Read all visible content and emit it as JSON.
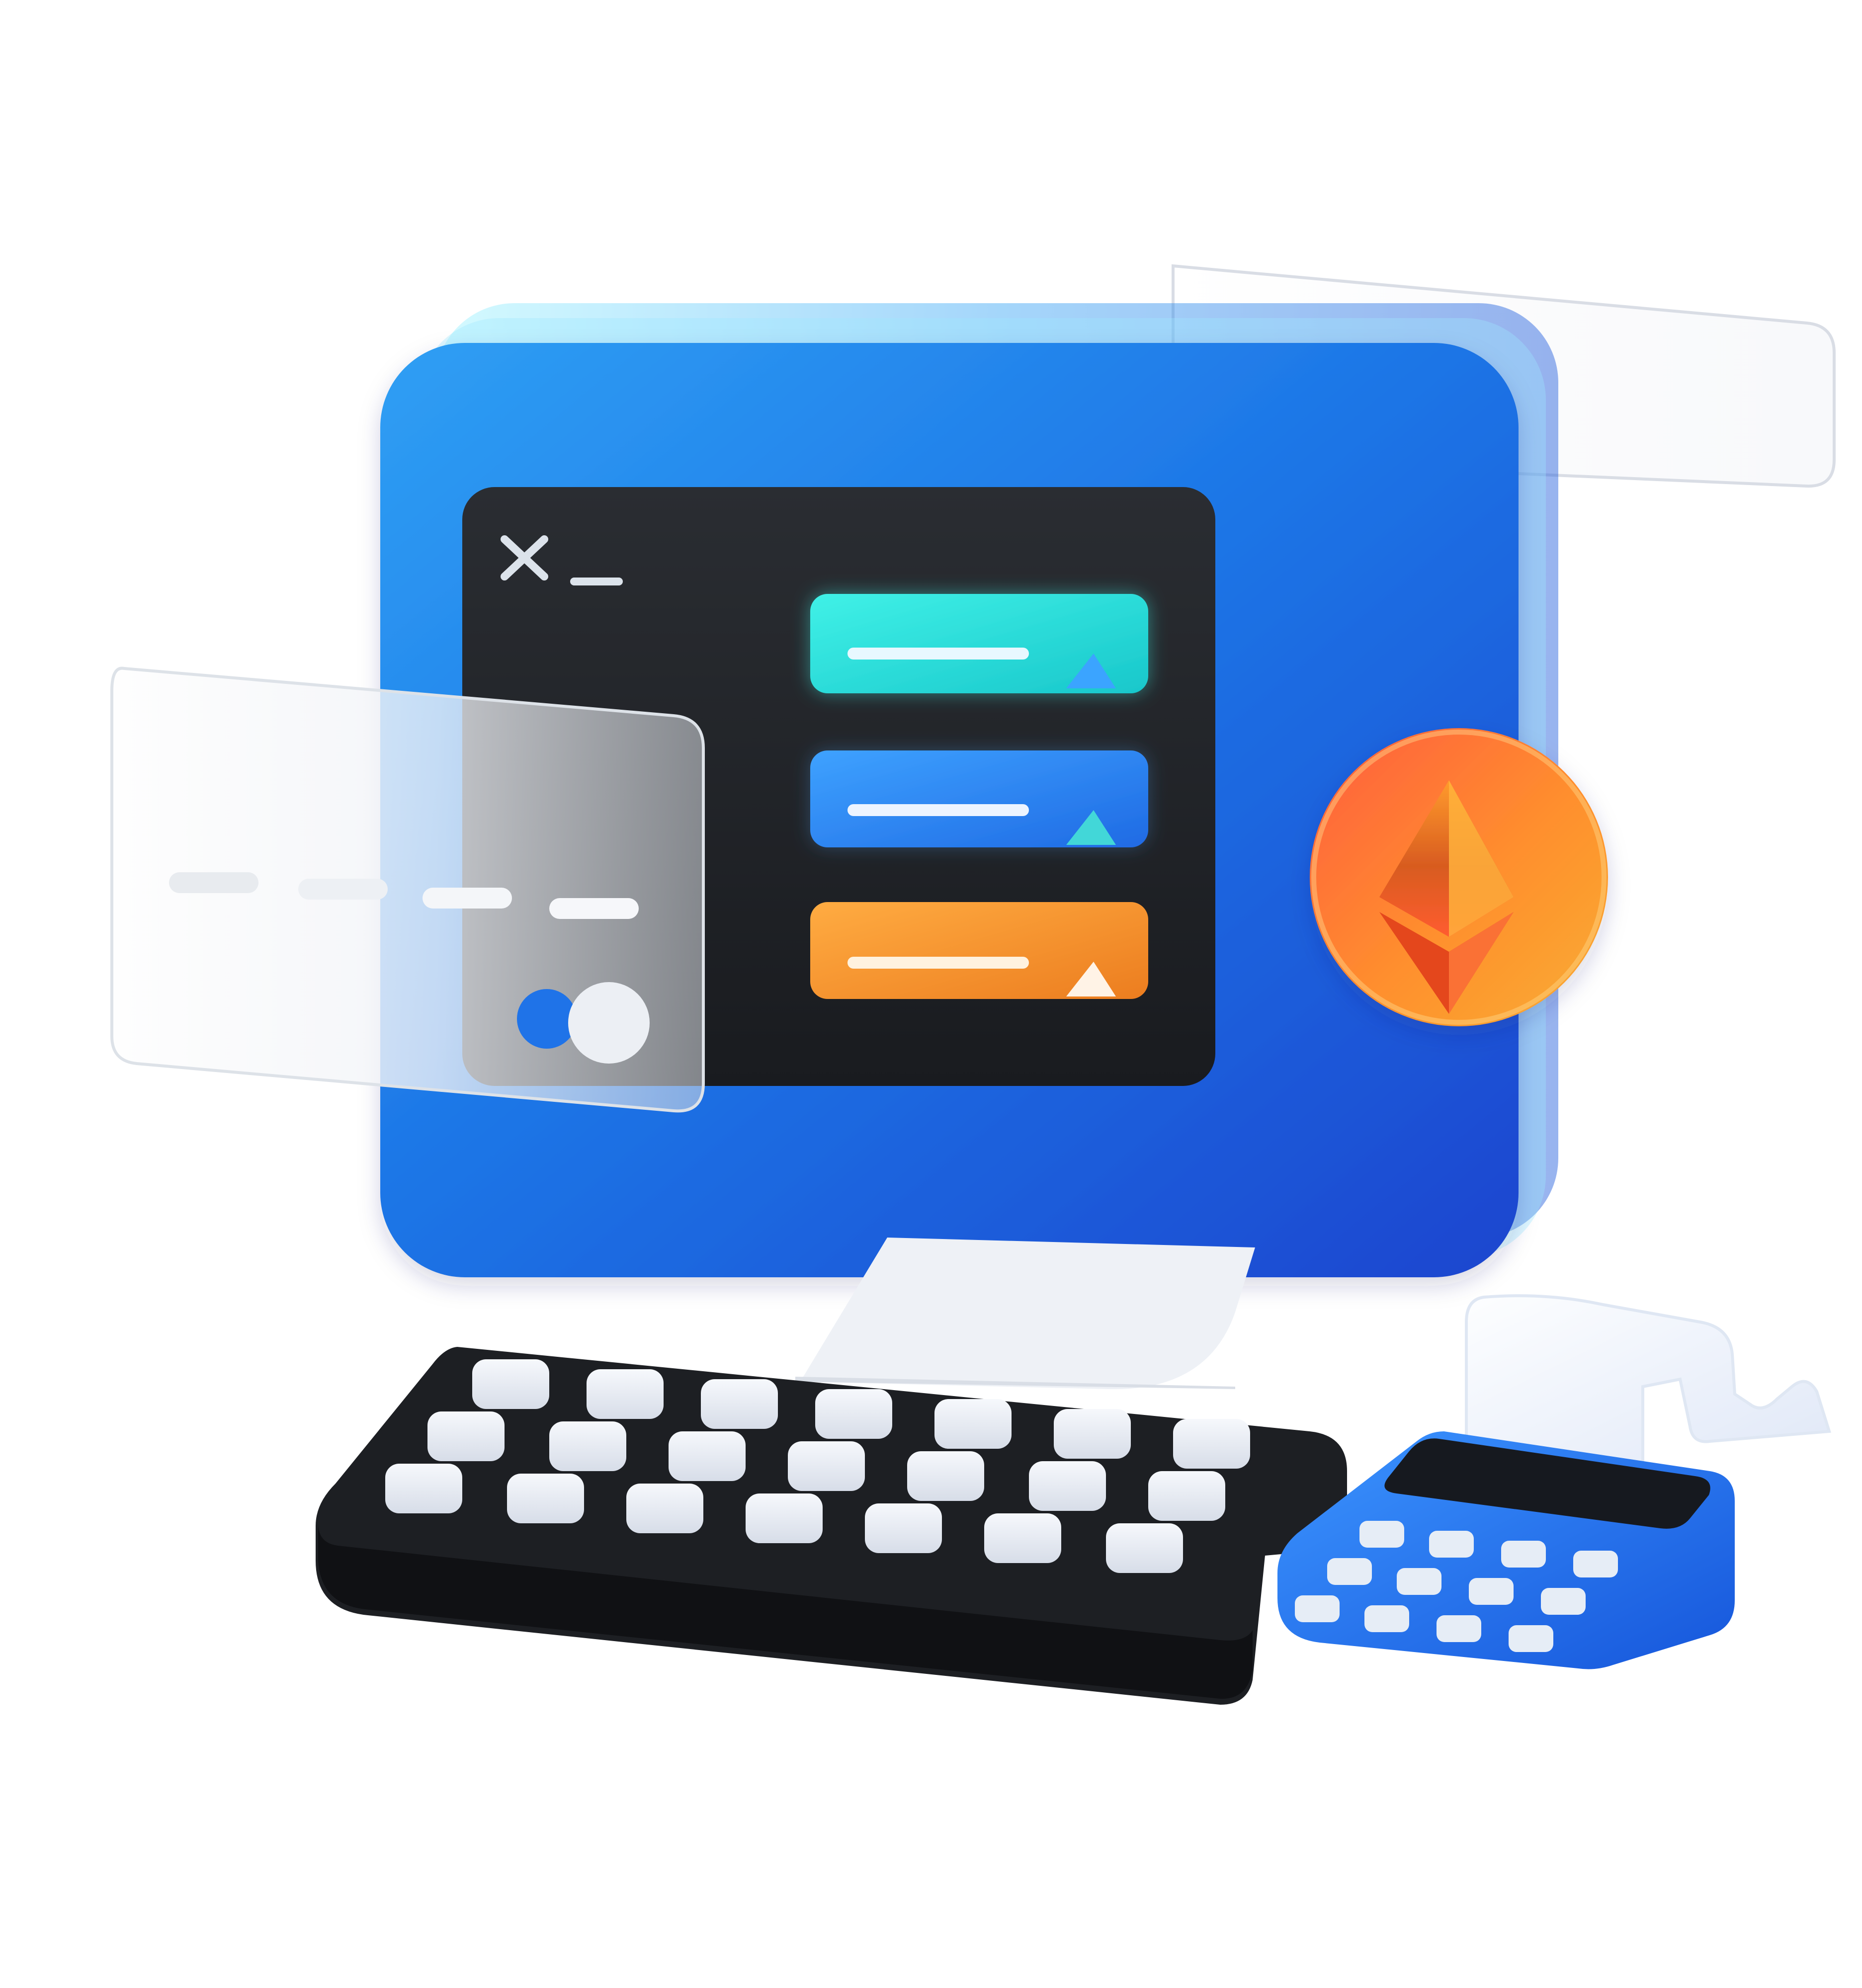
{
  "palette": {
    "monitor_blue_top": "#2b8ff0",
    "monitor_blue_bottom": "#1f4fd1",
    "screen_black": "#1d1f22",
    "teal": "#27d6d6",
    "blue": "#2c83ee",
    "orange": "#f29a2e",
    "coin_orange": "#f28f2f",
    "coin_red": "#eb5a2c",
    "key_light": "#e7ebf2",
    "keyboard_dark": "#1b1d21",
    "white_glass": "#f5f7fb",
    "neutral_stand": "#eef1f6"
  },
  "icons": {
    "close": "close-icon",
    "minimize": "minimize-icon",
    "ethereum": "ethereum-icon"
  },
  "screen": {
    "list_items": [
      {
        "name": "teal-list-item",
        "fill": "#27d6d6",
        "icon": "triangle-icon"
      },
      {
        "name": "blue-list-item",
        "fill": "#2c83ee",
        "icon": "triangle-icon"
      },
      {
        "name": "orange-list-item",
        "fill": "#f29a2e",
        "icon": "triangle-icon"
      }
    ]
  },
  "card": {
    "toggle": {
      "state": "on"
    }
  }
}
